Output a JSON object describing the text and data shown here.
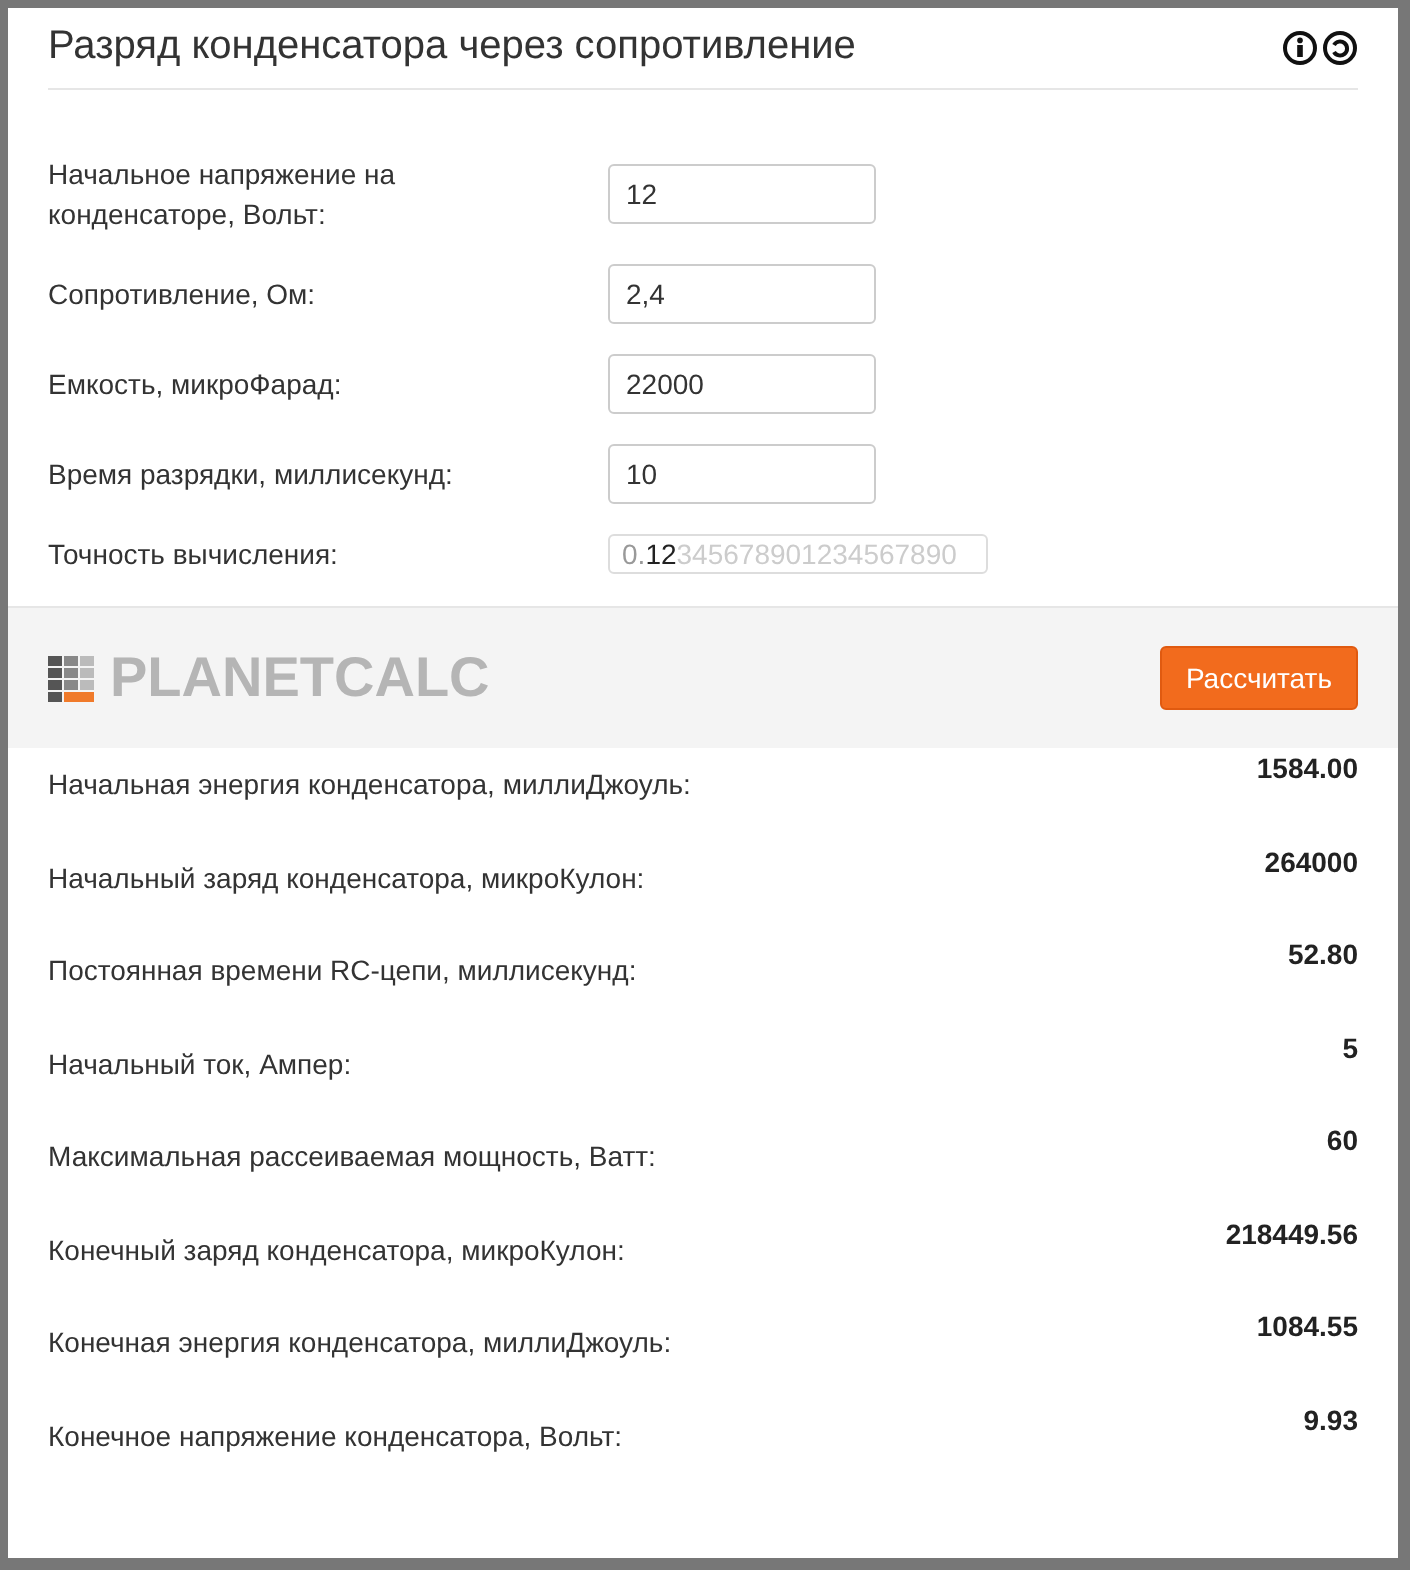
{
  "title": "Разряд конденсатора через сопротивление",
  "inputs": [
    {
      "label": "Начальное напряжение на конденсаторе, Вольт:",
      "value": "12"
    },
    {
      "label": "Сопротивление, Ом:",
      "value": "2,4"
    },
    {
      "label": "Емкость, микроФарад:",
      "value": "22000"
    },
    {
      "label": "Время разрядки, миллисекунд:",
      "value": "10"
    }
  ],
  "precision": {
    "label": "Точность вычисления:",
    "lead": "0.",
    "chosen": "12",
    "rest": "345678901234567890"
  },
  "logo": "PLANETCALC",
  "calculate_button": "Рассчитать",
  "results": [
    {
      "label": "Начальная энергия конденсатора, миллиДжоуль:",
      "value": "1584.00"
    },
    {
      "label": "Начальный заряд конденсатора, микроКулон:",
      "value": "264000"
    },
    {
      "label": "Постоянная времени RC-цепи, миллисекунд:",
      "value": "52.80"
    },
    {
      "label": "Начальный ток, Ампер:",
      "value": "5"
    },
    {
      "label": "Максимальная рассеиваемая мощность, Ватт:",
      "value": "60"
    },
    {
      "label": "Конечный заряд конденсатора, микроКулон:",
      "value": "218449.56"
    },
    {
      "label": "Конечная энергия конденсатора, миллиДжоуль:",
      "value": "1084.55"
    },
    {
      "label": "Конечное напряжение конденсатора, Вольт:",
      "value": "9.93"
    }
  ]
}
